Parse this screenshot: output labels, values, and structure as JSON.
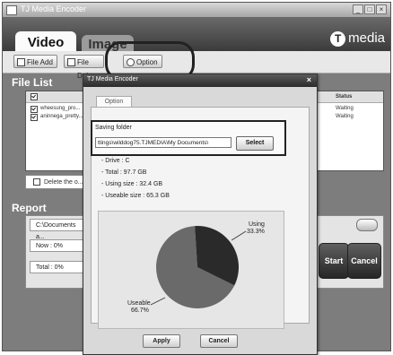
{
  "window": {
    "title": "TJ Media Encoder"
  },
  "tabs": [
    {
      "label": "Video"
    },
    {
      "label": "Image"
    }
  ],
  "logo": {
    "mark": "T",
    "text": "media"
  },
  "toolbar": {
    "file_add": "File Add",
    "file_del": "File Del",
    "option": "Option"
  },
  "file_list": {
    "title": "File List",
    "status_header": "Status",
    "rows": [
      {
        "name": "wheesung_pro...",
        "status": "Waiting",
        "checked": true
      },
      {
        "name": "aninnega_pretty...",
        "status": "Waiting",
        "checked": true
      }
    ],
    "delete_label": "Delete the o..."
  },
  "report": {
    "title": "Report",
    "path": "C:\\Documents a...",
    "now": "Now : 0%",
    "total": "Total : 0%",
    "start_button": "Start",
    "cancel_button": "Cancel"
  },
  "dialog": {
    "title": "TJ Media Encoder",
    "tab": "Option",
    "saving_folder_label": "Saving folder",
    "saving_folder_path": "ttings\\wilddog75.TJMEDIA\\My Documents\\",
    "select_button": "Select",
    "drive": "- Drive : C",
    "total": "- Total : 97.7 GB",
    "using": "- Using size : 32.4 GB",
    "useable": "- Useable size : 65.3 GB",
    "pie": {
      "using_label": "Using",
      "using_pct": "33.3%",
      "using_value": 33.3,
      "useable_label": "Useable",
      "useable_pct": "66.7%",
      "useable_value": 66.7,
      "using_color": "#2a2a2a",
      "useable_color": "#6a6a6a"
    },
    "apply_button": "Apply",
    "cancel_button": "Cancel"
  }
}
